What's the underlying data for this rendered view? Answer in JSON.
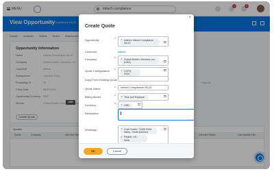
{
  "topbar": {
    "menu_label": "MENU",
    "search_value": "Initech compliance",
    "notif_badge": "1",
    "inbox_badge": "3"
  },
  "header": {
    "title": "View Opportunity",
    "subtitle": "Initech Compliance 08-24",
    "accent_color": "#0875e1"
  },
  "tabs": [
    "Details",
    "Analysis",
    "Status",
    "Notes",
    "Attachments"
  ],
  "card": {
    "title": "Opportunity Information",
    "rows": [
      {
        "label": "Name",
        "value": "Initech Compliance 08-24"
      },
      {
        "label": "Company",
        "value": "Global Modern Services, Inc."
      },
      {
        "label": "Customer",
        "value": "Initech"
      },
      {
        "label": "Salesperson",
        "value": "Lakshmi Curry"
      },
      {
        "label": "Probability %",
        "value": "70"
      },
      {
        "label": "Close Date",
        "value": "08/30/2024"
      },
      {
        "label": "Opportunity Currency",
        "value": "USD"
      },
      {
        "label": "Worker",
        "value": "Global Modern Services - Revenue"
      }
    ],
    "button_label": "Create Quote"
  },
  "table": {
    "heading": "Quotes",
    "columns": [
      "Quote",
      "Company",
      "Intended Status",
      "Last Updated"
    ],
    "right_note": "Intended Status",
    "right_col": "Last Updated By"
  },
  "right_text": "Reports",
  "modal": {
    "title": "Create Quote",
    "close_glyph": "×",
    "fields": {
      "opportunity": {
        "label": "Opportunity",
        "value": "Initech: Initech Compliance 08-24"
      },
      "customer": {
        "label": "Customer",
        "value": "Initech"
      },
      "company": {
        "label": "Company",
        "value": "Global Modern Services, Inc (USA)"
      },
      "quote_config": {
        "label": "Quote Configuration",
        "value": "CCPQ 2024"
      },
      "copy_from": {
        "label": "Copy From Existing Quote",
        "value": ""
      },
      "quote_name": {
        "label": "Quote Name",
        "value": "Initech Compliance 08-24"
      },
      "billing_model": {
        "label": "Billing Model",
        "value": "Time and Expense"
      },
      "currency": {
        "label": "Currency",
        "value": "USD"
      },
      "description": {
        "label": "Description",
        "value": ""
      },
      "worktags": {
        "label": "Worktags",
        "values": [
          "Cost Center: 71400 Field Sales - North America",
          "Region: US - West"
        ]
      }
    },
    "tooltip": "USD",
    "ok_label": "OK",
    "cancel_label": "Cancel",
    "ok_color": "#f5a623"
  }
}
